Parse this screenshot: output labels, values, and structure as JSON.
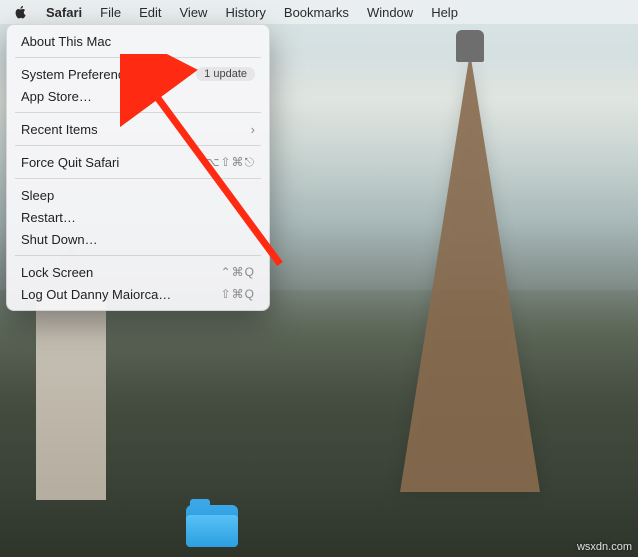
{
  "menubar": {
    "items": [
      {
        "label": "Safari",
        "active": true
      },
      {
        "label": "File"
      },
      {
        "label": "Edit"
      },
      {
        "label": "View"
      },
      {
        "label": "History"
      },
      {
        "label": "Bookmarks"
      },
      {
        "label": "Window"
      },
      {
        "label": "Help"
      }
    ]
  },
  "menu": {
    "about": "About This Mac",
    "sysprefs": "System Preferences…",
    "sysprefs_badge": "1 update",
    "appstore": "App Store…",
    "recent": "Recent Items",
    "forcequit": "Force Quit Safari",
    "forcequit_shortcut": "⌥⇧⌘⎋",
    "sleep": "Sleep",
    "restart": "Restart…",
    "shutdown": "Shut Down…",
    "lock": "Lock Screen",
    "lock_shortcut": "⌃⌘Q",
    "logout": "Log Out Danny Maiorca…",
    "logout_shortcut": "⇧⌘Q"
  },
  "watermark": "wsxdn.com",
  "colors": {
    "accent": "#0a63ff",
    "arrow": "#ff2a12",
    "folder": "#2d9fe0"
  }
}
